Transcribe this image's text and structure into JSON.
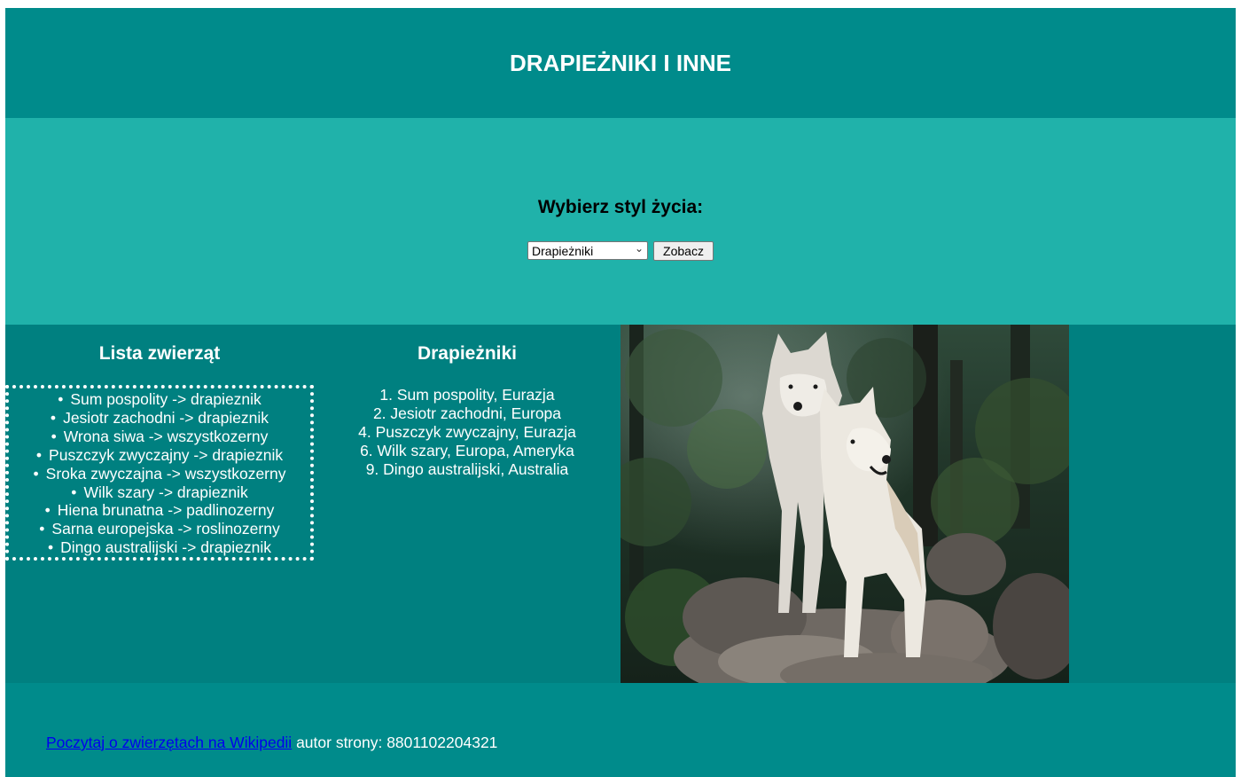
{
  "header": {
    "title": "DRAPIEŻNIKI I INNE"
  },
  "lifestyle_form": {
    "heading": "Wybierz styl życia:",
    "selected_option": "Drapieżniki",
    "submit_label": "Zobacz"
  },
  "animal_list": {
    "heading": "Lista zwierząt",
    "items": [
      "Sum pospolity -> drapieznik",
      "Jesiotr zachodni -> drapieznik",
      "Wrona siwa -> wszystkozerny",
      "Puszczyk zwyczajny -> drapieznik",
      "Sroka zwyczajna -> wszystkozerny",
      "Wilk szary -> drapieznik",
      "Hiena brunatna -> padlinozerny",
      "Sarna europejska -> roslinozerny",
      "Dingo australijski -> drapieznik"
    ]
  },
  "predators": {
    "heading": "Drapieżniki",
    "items": [
      "1. Sum pospolity, Eurazja",
      "2. Jesiotr zachodni, Europa",
      "4. Puszczyk zwyczajny, Eurazja",
      "6. Wilk szary, Europa, Ameryka",
      "9. Dingo australijski, Australia"
    ]
  },
  "photo": {
    "subject": "two-white-wolves-on-rocks"
  },
  "footer": {
    "link_text": "Poczytaj o zwierzętach na Wikipedii",
    "author_text": " autor strony: 8801102204321"
  },
  "colors": {
    "header_bg": "#008b8b",
    "form_bg": "#20b2aa",
    "main_bg": "#008080",
    "footer_bg": "#008b8b",
    "link": "#0000ee"
  }
}
